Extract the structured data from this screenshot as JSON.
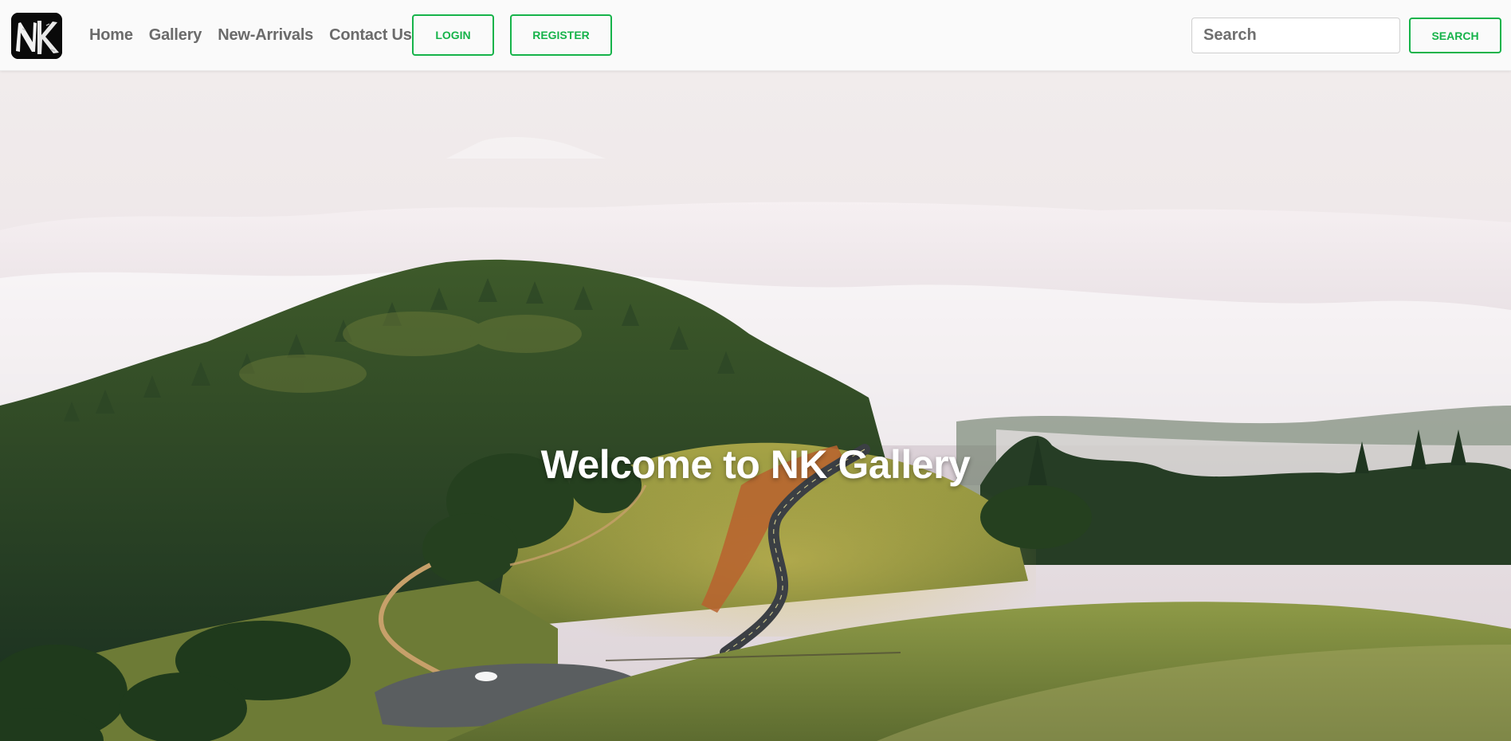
{
  "brand": {
    "logo_text": "NK",
    "logo_icon": "nk-logo-icon"
  },
  "nav": {
    "links": [
      {
        "label": "Home"
      },
      {
        "label": "Gallery"
      },
      {
        "label": "New-Arrivals"
      },
      {
        "label": "Contact Us"
      }
    ],
    "login_label": "LOGIN",
    "register_label": "REGISTER"
  },
  "search": {
    "placeholder": "Search",
    "value": "",
    "button_label": "SEARCH"
  },
  "hero": {
    "title": "Welcome to NK Gallery",
    "image": "landscape-hills-fog-road"
  },
  "colors": {
    "accent": "#16b34a",
    "nav_bg": "#fafafa",
    "nav_text": "#6b6b6b"
  }
}
